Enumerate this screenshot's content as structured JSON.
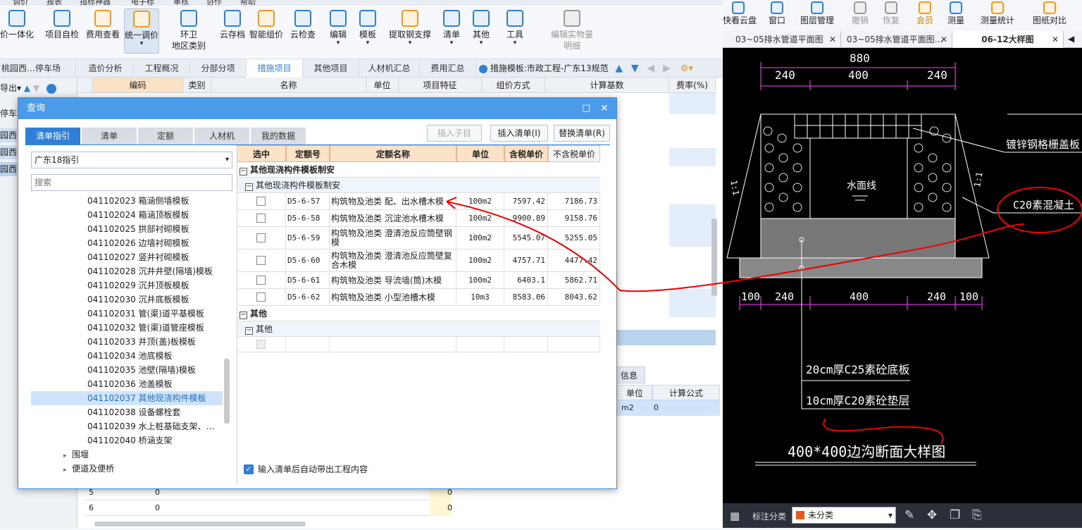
{
  "menubar": {
    "items": [
      "调价",
      "报表",
      "指标神器",
      "电子标",
      "审核",
      "协作",
      "帮助"
    ]
  },
  "ribbon": {
    "buttons": [
      {
        "label": "价一体化",
        "icon": "integration-icon"
      },
      {
        "label": "项目自检",
        "icon": "project-check-icon"
      },
      {
        "label": "费用查看",
        "icon": "fee-view-icon"
      },
      {
        "label": "统一调价",
        "icon": "price-adjust-icon"
      },
      {
        "label": "环卫\n地区类别",
        "icon": "region-icon"
      },
      {
        "label": "云存档",
        "icon": "cloud-save-icon"
      },
      {
        "label": "智能组价",
        "icon": "smart-price-icon"
      },
      {
        "label": "云检查",
        "icon": "cloud-check-icon"
      },
      {
        "label": "编辑",
        "icon": "edit-icon"
      },
      {
        "label": "模板",
        "icon": "template-icon"
      },
      {
        "label": "提取钢支撑",
        "icon": "extract-steel-icon"
      },
      {
        "label": "清单",
        "icon": "list-icon"
      },
      {
        "label": "其他",
        "icon": "other-icon"
      },
      {
        "label": "工具",
        "icon": "tools-icon"
      },
      {
        "label": "编辑实物量\n明细",
        "icon": "quantity-detail-icon"
      }
    ]
  },
  "project_tabs": {
    "left_title": "桃园西…停车场",
    "tabs": [
      "造价分析",
      "工程概况",
      "分部分项",
      "措施项目",
      "其他项目",
      "人材机汇总",
      "费用汇总"
    ],
    "template_label": "措施模板:市政工程-广东13规范"
  },
  "main_grid": {
    "headers": [
      "编码",
      "类别",
      "名称",
      "单位",
      "项目特征",
      "组价方式",
      "计算基数",
      "费率(%)"
    ],
    "left_labels": [
      "停车场",
      "园西路",
      "园西路",
      "园西路"
    ],
    "export_label": "导出",
    "bottom_rows": [
      {
        "num": "5",
        "val": "0",
        "right": "0"
      },
      {
        "num": "6",
        "val": "0",
        "right": "0"
      }
    ],
    "info_panel": {
      "tab": "信息",
      "unit_header": "单位",
      "formula_header": "计算公式",
      "unit": "m2",
      "value": "0"
    }
  },
  "dialog": {
    "title": "查询",
    "tabs": [
      "清单指引",
      "清单",
      "定额",
      "人材机",
      "我的数据"
    ],
    "buttons": {
      "insert_child": "插入子目",
      "insert_list": "插入清单(I)",
      "replace_list": "替换清单(R)"
    },
    "guide_select": "广东18指引",
    "search_placeholder": "搜索",
    "tree_items": [
      {
        "code": "041102023",
        "name": "箱涵侧墙模板"
      },
      {
        "code": "041102024",
        "name": "箱涵顶板模板"
      },
      {
        "code": "041102025",
        "name": "拱部衬砌模板"
      },
      {
        "code": "041102026",
        "name": "边墙衬砌模板"
      },
      {
        "code": "041102027",
        "name": "竖井衬砌模板"
      },
      {
        "code": "041102028",
        "name": "沉井井壁(隔墙)模板"
      },
      {
        "code": "041102029",
        "name": "沉井顶板模板"
      },
      {
        "code": "041102030",
        "name": "沉井底板模板"
      },
      {
        "code": "041102031",
        "name": "管(渠)道平基模板"
      },
      {
        "code": "041102032",
        "name": "管(渠)道管座模板"
      },
      {
        "code": "041102033",
        "name": "井顶(盖)板模板"
      },
      {
        "code": "041102034",
        "name": "池底模板"
      },
      {
        "code": "041102035",
        "name": "池壁(隔墙)模板"
      },
      {
        "code": "041102036",
        "name": "池盖模板"
      },
      {
        "code": "041102037",
        "name": "其他现浇构件模板"
      },
      {
        "code": "041102038",
        "name": "设备螺栓套"
      },
      {
        "code": "041102039",
        "name": "水上桩基础支架、…"
      },
      {
        "code": "041102040",
        "name": "桥涵支架"
      }
    ],
    "tree_groups": [
      "围堰",
      "便道及便桥"
    ],
    "table_headers": [
      "选中",
      "定额号",
      "定额名称",
      "单位",
      "含税单价",
      "不含税单价"
    ],
    "group1": "其他现浇构件模板制安",
    "group1_sub": "其他现浇构件模板制安",
    "rows": [
      {
        "code": "D5-6-57",
        "name": "构筑物及池类 配、出水槽木模",
        "unit": "100m2",
        "tax": "7597.42",
        "notax": "7186.73"
      },
      {
        "code": "D5-6-58",
        "name": "构筑物及池类 沉淀池水槽木模",
        "unit": "100m2",
        "tax": "9900.89",
        "notax": "9158.76"
      },
      {
        "code": "D5-6-59",
        "name": "构筑物及池类 澄清池反应筒壁钢模",
        "unit": "100m2",
        "tax": "5545.07",
        "notax": "5255.05"
      },
      {
        "code": "D5-6-60",
        "name": "构筑物及池类 澄清池反应筒壁复合木模",
        "unit": "100m2",
        "tax": "4757.71",
        "notax": "4477.42"
      },
      {
        "code": "D5-6-61",
        "name": "构筑物及池类 导流墙(筒)木模",
        "unit": "100m2",
        "tax": "6403.1",
        "notax": "5862.71"
      },
      {
        "code": "D5-6-62",
        "name": "构筑物及池类 小型池槽木模",
        "unit": "10m3",
        "tax": "8583.06",
        "notax": "8043.62"
      }
    ],
    "group2": "其他",
    "group2_sub": "其他",
    "auto_bring_label": "输入清单后自动带出工程内容"
  },
  "cad": {
    "toolbar": [
      {
        "label": "快看云盘",
        "icon": "cloud-disk-icon"
      },
      {
        "label": "窗口",
        "icon": "window-icon"
      },
      {
        "label": "图层管理",
        "icon": "layers-icon"
      },
      {
        "label": "撤销",
        "icon": "undo-icon"
      },
      {
        "label": "恢复",
        "icon": "redo-icon"
      },
      {
        "label": "会员",
        "icon": "vip-icon"
      },
      {
        "label": "测量",
        "icon": "measure-icon"
      },
      {
        "label": "测量统计",
        "icon": "measure-stats-icon"
      },
      {
        "label": "图纸对比",
        "icon": "compare-icon"
      }
    ],
    "tabs": [
      "03~05排水管道平面图",
      "03~05排水管道平面图…",
      "06-12大样图"
    ],
    "dims_top": {
      "total": "880",
      "a": "240",
      "b": "400",
      "c": "240"
    },
    "dims_bottom": [
      "100",
      "240",
      "400",
      "240",
      "100"
    ],
    "slope_left": "1:1",
    "slope_right": "1:1",
    "label_cover": "镀锌钢格栅盖板",
    "label_water": "水面线",
    "label_c20": "C20素混凝土",
    "label_base1": "20cm厚C25素砼底板",
    "label_base2": "10cm厚C20素砼垫层",
    "title": "400*400边沟断面大样图",
    "bottom_label": "标注分类",
    "bottom_select": "未分类"
  }
}
